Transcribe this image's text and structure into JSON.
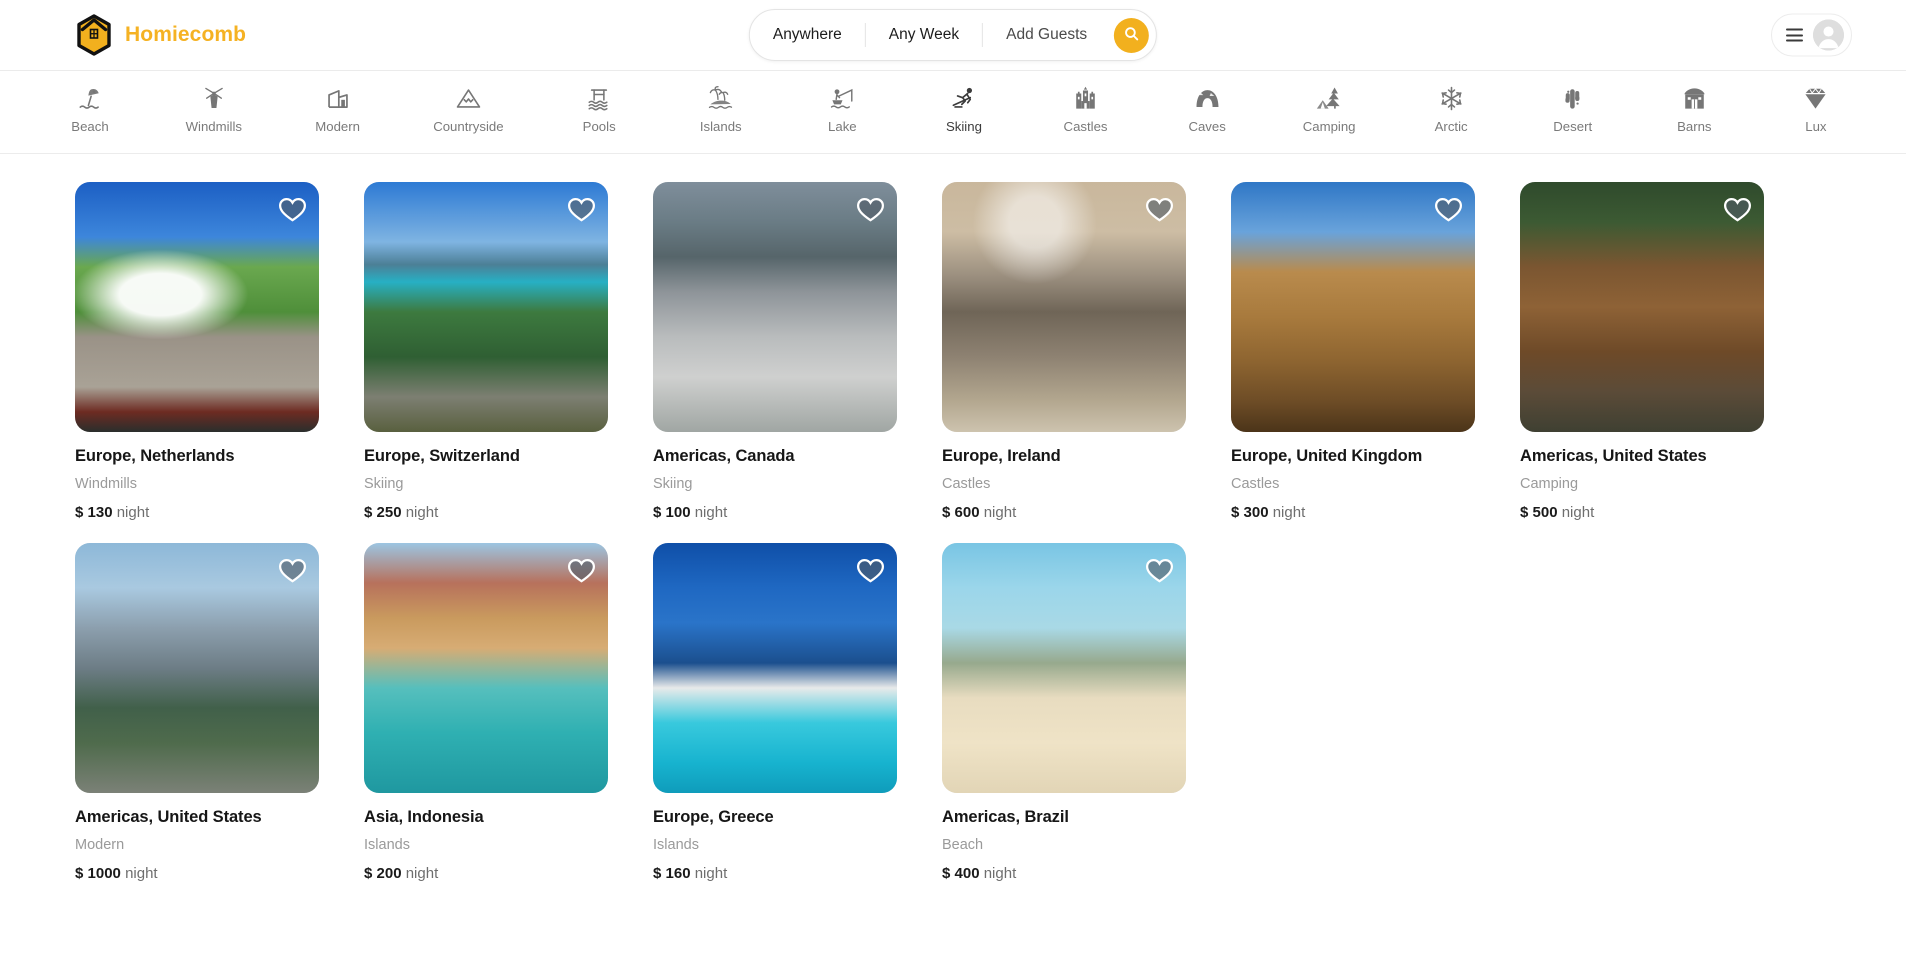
{
  "brand": {
    "name": "Homiecomb",
    "color": "#f5b223",
    "logo_icon": "honeycomb-house-logo"
  },
  "search": {
    "location_label": "Anywhere",
    "dates_label": "Any Week",
    "guests_label": "Add Guests",
    "search_icon": "search-icon",
    "button_color": "#f2b01e"
  },
  "user_menu": {
    "menu_icon": "hamburger-icon",
    "avatar_icon": "user-avatar-icon"
  },
  "categories": [
    {
      "label": "Beach",
      "icon": "beach-umbrella-icon",
      "active": false
    },
    {
      "label": "Windmills",
      "icon": "windmill-icon",
      "active": false
    },
    {
      "label": "Modern",
      "icon": "modern-house-icon",
      "active": false
    },
    {
      "label": "Countryside",
      "icon": "mountain-icon",
      "active": false
    },
    {
      "label": "Pools",
      "icon": "pool-icon",
      "active": false
    },
    {
      "label": "Islands",
      "icon": "island-palm-icon",
      "active": false
    },
    {
      "label": "Lake",
      "icon": "fishing-boat-icon",
      "active": false
    },
    {
      "label": "Skiing",
      "icon": "skier-icon",
      "active": true
    },
    {
      "label": "Castles",
      "icon": "castle-icon",
      "active": false
    },
    {
      "label": "Caves",
      "icon": "cave-icon",
      "active": false
    },
    {
      "label": "Camping",
      "icon": "tent-tree-icon",
      "active": false
    },
    {
      "label": "Arctic",
      "icon": "snowflake-icon",
      "active": false
    },
    {
      "label": "Desert",
      "icon": "cactus-icon",
      "active": false
    },
    {
      "label": "Barns",
      "icon": "barn-icon",
      "active": false
    },
    {
      "label": "Lux",
      "icon": "diamond-icon",
      "active": false
    }
  ],
  "listings": [
    {
      "title": "Europe, Netherlands",
      "category": "Windmills",
      "currency": "$",
      "price": "130",
      "unit": "night",
      "favorite_icon": "heart-icon",
      "photo": "ph-netherlands"
    },
    {
      "title": "Europe, Switzerland",
      "category": "Skiing",
      "currency": "$",
      "price": "250",
      "unit": "night",
      "favorite_icon": "heart-icon",
      "photo": "ph-switzerland"
    },
    {
      "title": "Americas, Canada",
      "category": "Skiing",
      "currency": "$",
      "price": "100",
      "unit": "night",
      "favorite_icon": "heart-icon",
      "photo": "ph-canada"
    },
    {
      "title": "Europe, Ireland",
      "category": "Castles",
      "currency": "$",
      "price": "600",
      "unit": "night",
      "favorite_icon": "heart-icon",
      "photo": "ph-ireland"
    },
    {
      "title": "Europe, United Kingdom",
      "category": "Castles",
      "currency": "$",
      "price": "300",
      "unit": "night",
      "favorite_icon": "heart-icon",
      "photo": "ph-uk"
    },
    {
      "title": "Americas, United States",
      "category": "Camping",
      "currency": "$",
      "price": "500",
      "unit": "night",
      "favorite_icon": "heart-icon",
      "photo": "ph-camping"
    },
    {
      "title": "Americas, United States",
      "category": "Modern",
      "currency": "$",
      "price": "1000",
      "unit": "night",
      "favorite_icon": "heart-icon",
      "photo": "ph-nyc"
    },
    {
      "title": "Asia, Indonesia",
      "category": "Islands",
      "currency": "$",
      "price": "200",
      "unit": "night",
      "favorite_icon": "heart-icon",
      "photo": "ph-indonesia"
    },
    {
      "title": "Europe, Greece",
      "category": "Islands",
      "currency": "$",
      "price": "160",
      "unit": "night",
      "favorite_icon": "heart-icon",
      "photo": "ph-greece"
    },
    {
      "title": "Americas, Brazil",
      "category": "Beach",
      "currency": "$",
      "price": "400",
      "unit": "night",
      "favorite_icon": "heart-icon",
      "photo": "ph-brazil"
    }
  ]
}
